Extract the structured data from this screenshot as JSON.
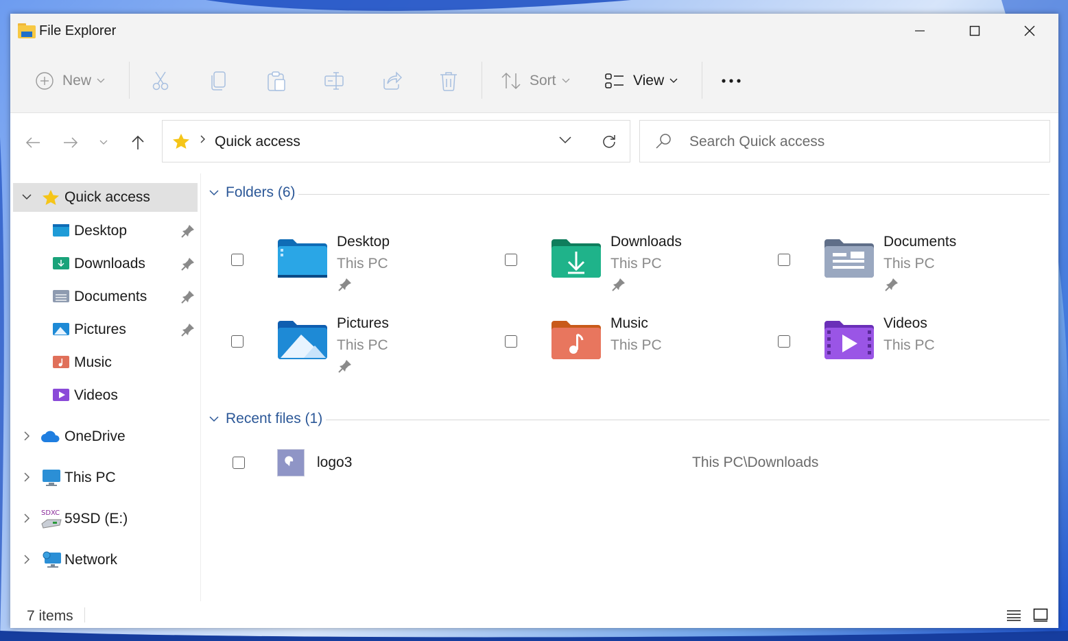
{
  "window": {
    "title": "File Explorer"
  },
  "toolbar": {
    "new_label": "New",
    "sort_label": "Sort",
    "view_label": "View"
  },
  "address": {
    "location": "Quick access"
  },
  "search": {
    "placeholder": "Search Quick access"
  },
  "sidebar": {
    "quick_access": "Quick access",
    "pinned": [
      {
        "label": "Desktop"
      },
      {
        "label": "Downloads"
      },
      {
        "label": "Documents"
      },
      {
        "label": "Pictures"
      },
      {
        "label": "Music"
      },
      {
        "label": "Videos"
      }
    ],
    "roots": [
      {
        "label": "OneDrive"
      },
      {
        "label": "This PC"
      },
      {
        "label": "59SD (E:)"
      },
      {
        "label": "Network"
      }
    ]
  },
  "main": {
    "folders_title": "Folders (6)",
    "folders": [
      {
        "name": "Desktop",
        "location": "This PC",
        "pinned": true
      },
      {
        "name": "Downloads",
        "location": "This PC",
        "pinned": true
      },
      {
        "name": "Documents",
        "location": "This PC",
        "pinned": true
      },
      {
        "name": "Pictures",
        "location": "This PC",
        "pinned": true
      },
      {
        "name": "Music",
        "location": "This PC",
        "pinned": false
      },
      {
        "name": "Videos",
        "location": "This PC",
        "pinned": false
      }
    ],
    "recent_title": "Recent files (1)",
    "recent": [
      {
        "name": "logo3",
        "path": "This PC\\Downloads"
      }
    ]
  },
  "status": {
    "items_text": "7 items"
  },
  "colors": {
    "section_accent": "#2b5797",
    "selected_bg": "#e1e1e1",
    "toolbar_bg": "#f3f3f3"
  },
  "sd_badge": "SDXC"
}
